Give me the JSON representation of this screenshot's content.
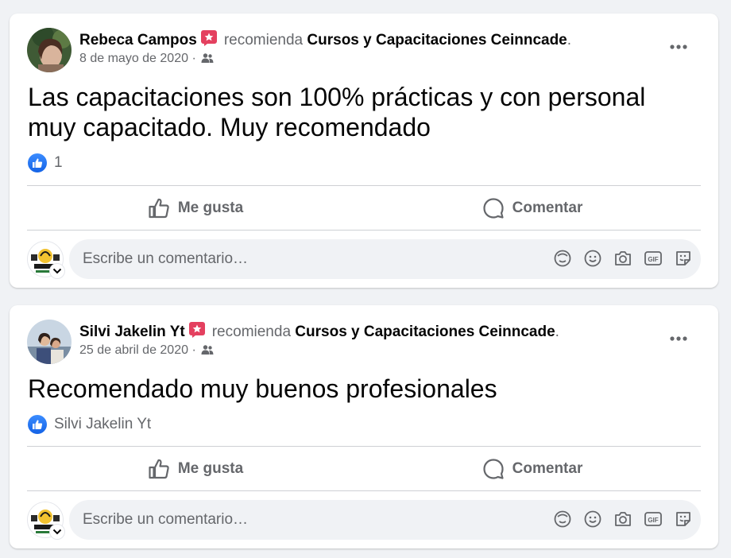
{
  "page_name": "Cursos y Capacitaciones Ceinncade",
  "verb": "recomienda",
  "comment_placeholder": "Escribe un comentario…",
  "actions": {
    "like": "Me gusta",
    "comment": "Comentar"
  },
  "posts": [
    {
      "author": "Rebeca Campos",
      "date": "8 de mayo de 2020",
      "text": "Las capacitaciones son 100% prácticas y con personal muy capacitado. Muy recomendado",
      "reactions": "1"
    },
    {
      "author": "Silvi Jakelin Yt",
      "date": "25 de abril de 2020",
      "text": "Recomendado muy buenos profesionales",
      "reactions": "Silvi Jakelin Yt"
    }
  ],
  "icons": {
    "badge": "recommend-badge-icon",
    "audience": "friends-icon",
    "more": "more-options-icon",
    "like": "thumbs-up-icon",
    "comment": "comment-bubble-icon",
    "avatar_sticker": "avatar-sticker-icon",
    "emoji": "emoji-icon",
    "camera": "camera-icon",
    "gif": "gif-icon",
    "sticker": "sticker-icon"
  },
  "colors": {
    "brand_blue": "#1877f2",
    "badge_red": "#e4405f",
    "secondary_text": "#65676b"
  }
}
